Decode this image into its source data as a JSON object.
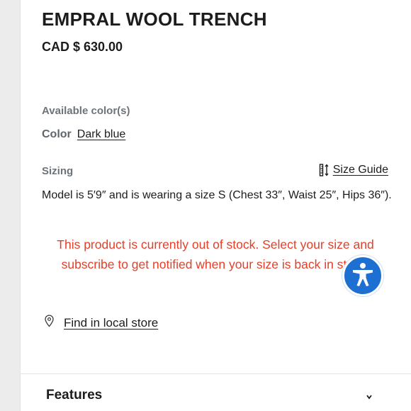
{
  "product": {
    "title": "EMPRAL WOOL TRENCH",
    "price": "CAD $ 630.00"
  },
  "colors": {
    "section_label": "Available color(s)",
    "label": "Color",
    "value": "Dark blue"
  },
  "sizing": {
    "label": "Sizing",
    "guide_label": "Size Guide",
    "guide_icon": "ruler-icon",
    "model_info": "Model is 5′9″ and is wearing a size S (Chest 33″, Waist 25″, Hips 36″)."
  },
  "stock": {
    "message": "This product is currently out of stock. Select your size and subscribe to get notified when your size is back in stock."
  },
  "store": {
    "icon": "map-pin-icon",
    "label": "Find in local store"
  },
  "accordion": {
    "features_label": "Features",
    "icon": "chevron-icon"
  },
  "accessibility": {
    "icon": "accessibility-icon"
  },
  "colors_theme": {
    "alert": "#e2402b",
    "accessibility_button": "#1d6fd1",
    "muted_label": "#6d737a"
  }
}
